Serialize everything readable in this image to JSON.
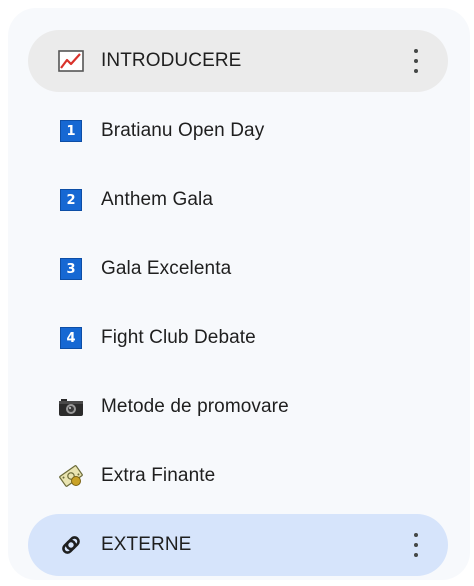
{
  "nav": {
    "header": {
      "label": "INTRODUCERE",
      "icon": "chart-line-icon"
    },
    "items": [
      {
        "label": "Bratianu Open Day",
        "badge": "1",
        "icon": "number-badge-icon"
      },
      {
        "label": "Anthem Gala",
        "badge": "2",
        "icon": "number-badge-icon"
      },
      {
        "label": "Gala Excelenta",
        "badge": "3",
        "icon": "number-badge-icon"
      },
      {
        "label": "Fight Club Debate",
        "badge": "4",
        "icon": "number-badge-icon"
      },
      {
        "label": "Metode de promovare",
        "icon": "camera-icon"
      },
      {
        "label": "Extra Finante",
        "icon": "money-icon"
      }
    ],
    "footer": {
      "label": "EXTERNE",
      "icon": "paperclip-icon"
    }
  },
  "colors": {
    "panel_bg": "#f7f9fc",
    "header_bg": "#ebebeb",
    "active_bg": "#d6e4fb",
    "badge_blue": "#1668d3",
    "chart_red": "#d9322b"
  }
}
